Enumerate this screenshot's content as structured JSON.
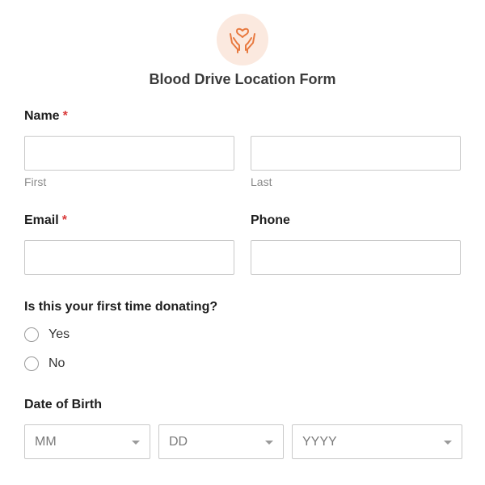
{
  "header": {
    "title": "Blood Drive Location Form",
    "logo_icon": "heart-in-hands-icon",
    "accent_color": "#e8793f",
    "logo_bg_color": "#fbe9df"
  },
  "fields": {
    "name": {
      "label": "Name",
      "required_mark": "*",
      "first_sublabel": "First",
      "last_sublabel": "Last",
      "first_value": "",
      "last_value": ""
    },
    "email": {
      "label": "Email",
      "required_mark": "*",
      "value": ""
    },
    "phone": {
      "label": "Phone",
      "value": ""
    },
    "first_time": {
      "question": "Is this your first time donating?",
      "options": [
        {
          "label": "Yes",
          "selected": false
        },
        {
          "label": "No",
          "selected": false
        }
      ]
    },
    "dob": {
      "label": "Date of Birth",
      "month_placeholder": "MM",
      "day_placeholder": "DD",
      "year_placeholder": "YYYY"
    }
  }
}
